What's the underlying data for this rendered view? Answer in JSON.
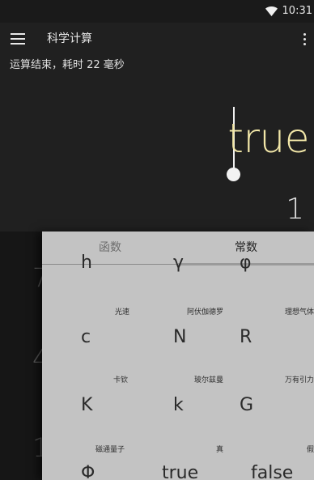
{
  "status_bar": {
    "time": "10:31",
    "wifi_icon": "wifi-icon"
  },
  "app_bar": {
    "menu_icon": "menu-icon",
    "title": "科学计算",
    "overflow_icon": "overflow-menu-icon"
  },
  "status_message": "运算结束，耗时 22 毫秒",
  "display": {
    "result": "true",
    "secondary": "1"
  },
  "background_digits": [
    "7",
    "4",
    "1"
  ],
  "panel": {
    "tabs": [
      {
        "label": "函数",
        "selected": false
      },
      {
        "label": "常数",
        "selected": true
      }
    ],
    "rows": [
      [
        {
          "label": "",
          "symbol": "h"
        },
        {
          "label": "",
          "symbol": "γ"
        },
        {
          "label": "",
          "symbol": "φ"
        }
      ],
      [
        {
          "label": "光速",
          "symbol": "c"
        },
        {
          "label": "阿伏伽德罗",
          "symbol": "N"
        },
        {
          "label": "理想气体",
          "symbol": "R"
        }
      ],
      [
        {
          "label": "卡钦",
          "symbol": "K"
        },
        {
          "label": "玻尔兹曼",
          "symbol": "k"
        },
        {
          "label": "万有引力",
          "symbol": "G"
        }
      ],
      [
        {
          "label": "磁通量子",
          "symbol": "Φ"
        },
        {
          "label": "真",
          "symbol": "true"
        },
        {
          "label": "假",
          "symbol": "false"
        }
      ]
    ]
  },
  "colors": {
    "background": "#202020",
    "result": "#f2e7a8",
    "panel": "#c3c3c3"
  }
}
